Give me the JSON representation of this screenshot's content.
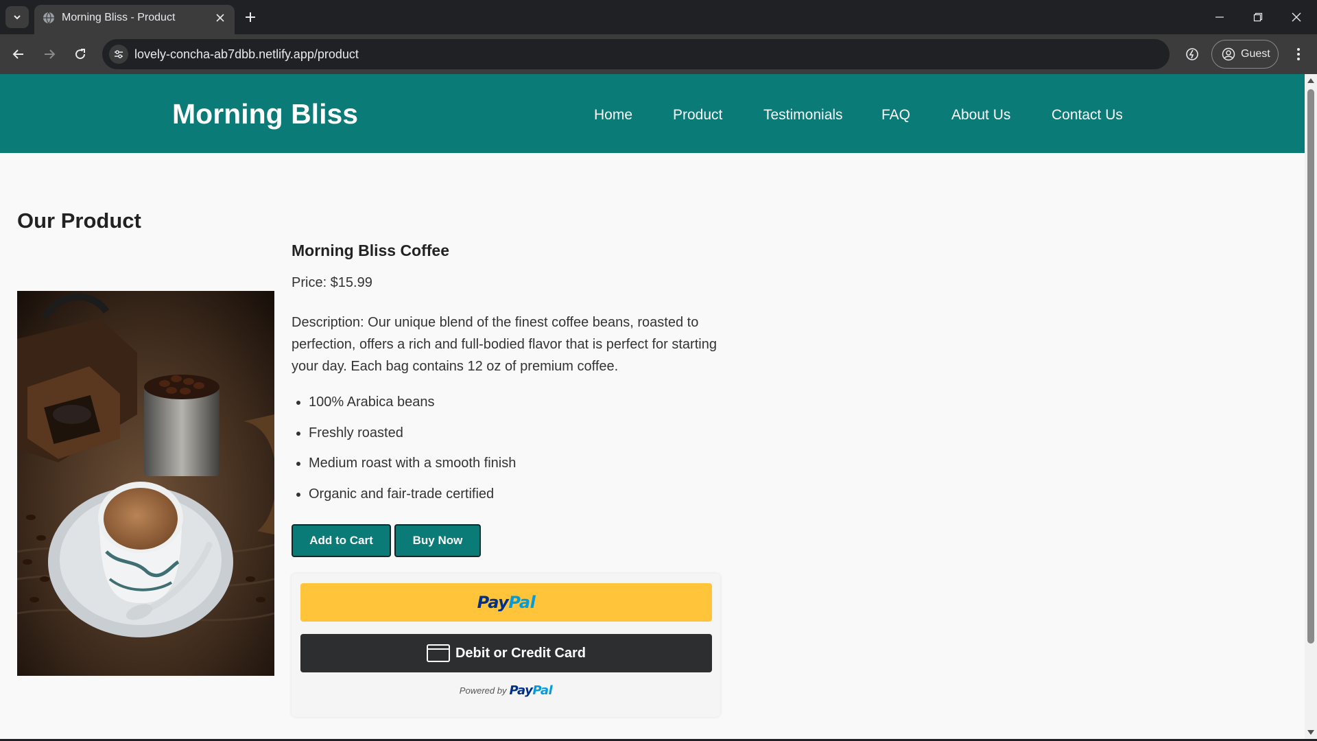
{
  "browser": {
    "tab_title": "Morning Bliss - Product",
    "url": "lovely-concha-ab7dbb.netlify.app/product",
    "profile_label": "Guest"
  },
  "site": {
    "brand": "Morning Bliss",
    "nav": [
      "Home",
      "Product",
      "Testimonials",
      "FAQ",
      "About Us",
      "Contact Us"
    ],
    "accent_color": "#0b7b77"
  },
  "product_section": {
    "title": "Our Product",
    "name": "Morning Bliss Coffee",
    "price": "Price: $15.99",
    "description": "Description: Our unique blend of the finest coffee beans, roasted to perfection, offers a rich and full-bodied flavor that is perfect for starting your day. Each bag contains 12 oz of premium coffee.",
    "features": [
      "100% Arabica beans",
      "Freshly roasted",
      "Medium roast with a smooth finish",
      "Organic and fair-trade certified"
    ],
    "add_to_cart_label": "Add to Cart",
    "buy_now_label": "Buy Now"
  },
  "paypal": {
    "logo_pay": "Pay",
    "logo_pal": "Pal",
    "card_label": "Debit or Credit Card",
    "powered_by": "Powered by",
    "paypal_yellow": "#ffc439",
    "card_dark": "#2c2e2f"
  }
}
